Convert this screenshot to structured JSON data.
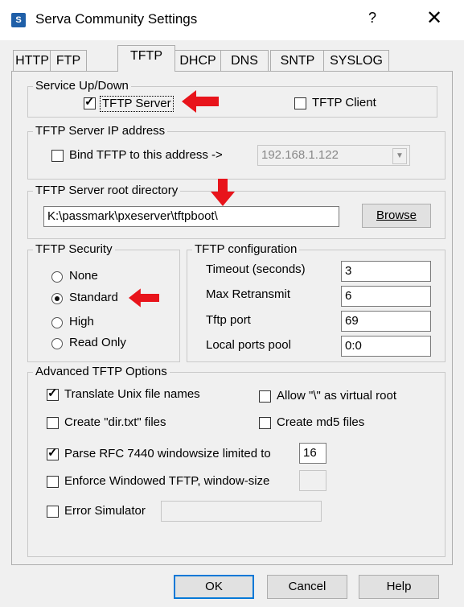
{
  "window": {
    "title": "Serva Community Settings",
    "icon_label": "S",
    "help": "?",
    "close": "✕"
  },
  "tabs": [
    {
      "label": "HTTP",
      "active": false
    },
    {
      "label": "FTP",
      "active": false
    },
    {
      "label": "TFTP",
      "active": true
    },
    {
      "label": "DHCP",
      "active": false
    },
    {
      "label": "DNS",
      "active": false
    },
    {
      "label": "SNTP",
      "active": false
    },
    {
      "label": "SYSLOG",
      "active": false
    }
  ],
  "service": {
    "title": "Service Up/Down",
    "tftp_server": {
      "label": "TFTP Server",
      "checked": true
    },
    "tftp_client": {
      "label": "TFTP Client",
      "checked": false
    }
  },
  "ip": {
    "title": "TFTP Server IP address",
    "bind_label": "Bind TFTP to this address  ->",
    "bind_checked": false,
    "address": "192.168.1.122"
  },
  "root": {
    "title": "TFTP Server root directory",
    "path": "K:\\passmark\\pxeserver\\tftpboot\\",
    "browse": "Browse"
  },
  "security": {
    "title": "TFTP Security",
    "options": [
      {
        "label": "None",
        "selected": false
      },
      {
        "label": "Standard",
        "selected": true
      },
      {
        "label": "High",
        "selected": false
      },
      {
        "label": "Read Only",
        "selected": false
      }
    ]
  },
  "config": {
    "title": "TFTP configuration",
    "rows": [
      {
        "label": "Timeout (seconds)",
        "value": "3"
      },
      {
        "label": "Max Retransmit",
        "value": "6"
      },
      {
        "label": "Tftp port",
        "value": "69"
      },
      {
        "label": "Local ports pool",
        "value": "0:0"
      }
    ]
  },
  "advanced": {
    "title": "Advanced TFTP Options",
    "translate_unix": {
      "label": "Translate Unix file names",
      "checked": true
    },
    "allow_backslash": {
      "label": "Allow \"\\\" as virtual root",
      "checked": false
    },
    "create_dir": {
      "label": "Create \"dir.txt\" files",
      "checked": false
    },
    "create_md5": {
      "label": "Create md5 files",
      "checked": false
    },
    "parse_rfc": {
      "label": "Parse RFC 7440 windowsize limited to",
      "checked": true,
      "value": "16"
    },
    "enforce_windowed": {
      "label": "Enforce Windowed TFTP, window-size",
      "checked": false,
      "value": ""
    },
    "error_sim": {
      "label": "Error Simulator",
      "checked": false,
      "value": ""
    }
  },
  "footer": {
    "ok": "OK",
    "cancel": "Cancel",
    "help": "Help"
  },
  "colors": {
    "accent": "#0078d7",
    "annotation_arrow": "#e8141b"
  }
}
